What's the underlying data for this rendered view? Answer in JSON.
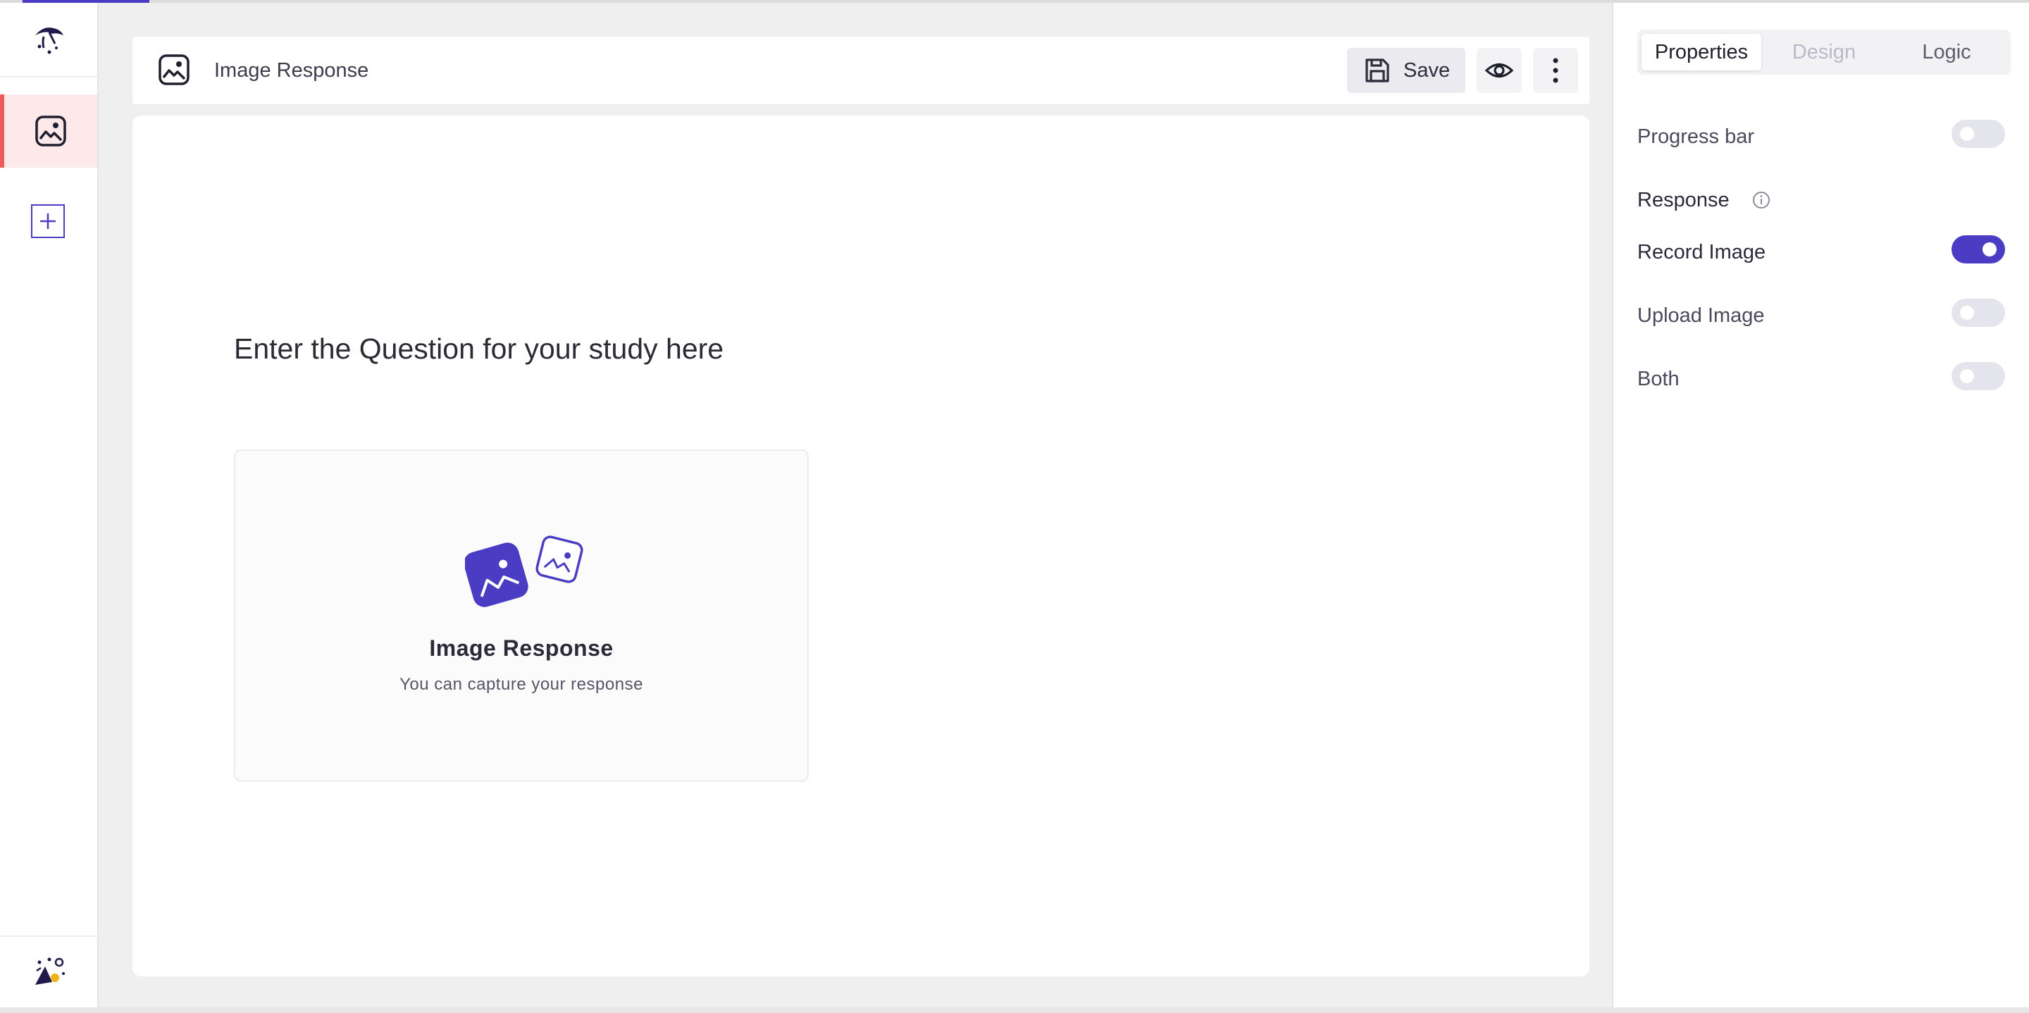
{
  "header": {
    "title": "Image Response",
    "save_label": "Save"
  },
  "canvas": {
    "question": "Enter the Question for your study here",
    "response_card": {
      "title": "Image Response",
      "subtitle": "You can capture your response"
    }
  },
  "panel": {
    "tabs": [
      {
        "label": "Properties",
        "active": true
      },
      {
        "label": "Design",
        "active": false
      },
      {
        "label": "Logic",
        "active": false
      }
    ],
    "progress_bar": {
      "label": "Progress bar",
      "on": false
    },
    "response_section": "Response",
    "options": [
      {
        "label": "Record Image",
        "on": true
      },
      {
        "label": "Upload Image",
        "on": false
      },
      {
        "label": "Both",
        "on": false
      }
    ]
  },
  "colors": {
    "accent": "#4b3cc4",
    "active_nav_bg": "#fde9e9",
    "active_nav_border": "#ee5b5b"
  },
  "icons": {
    "logo": "app-logo-icon",
    "nav_item": "image-icon",
    "add": "plus-icon",
    "save": "floppy-disk-icon",
    "preview": "eye-icon",
    "more": "kebab-menu-icon",
    "info": "info-icon"
  }
}
